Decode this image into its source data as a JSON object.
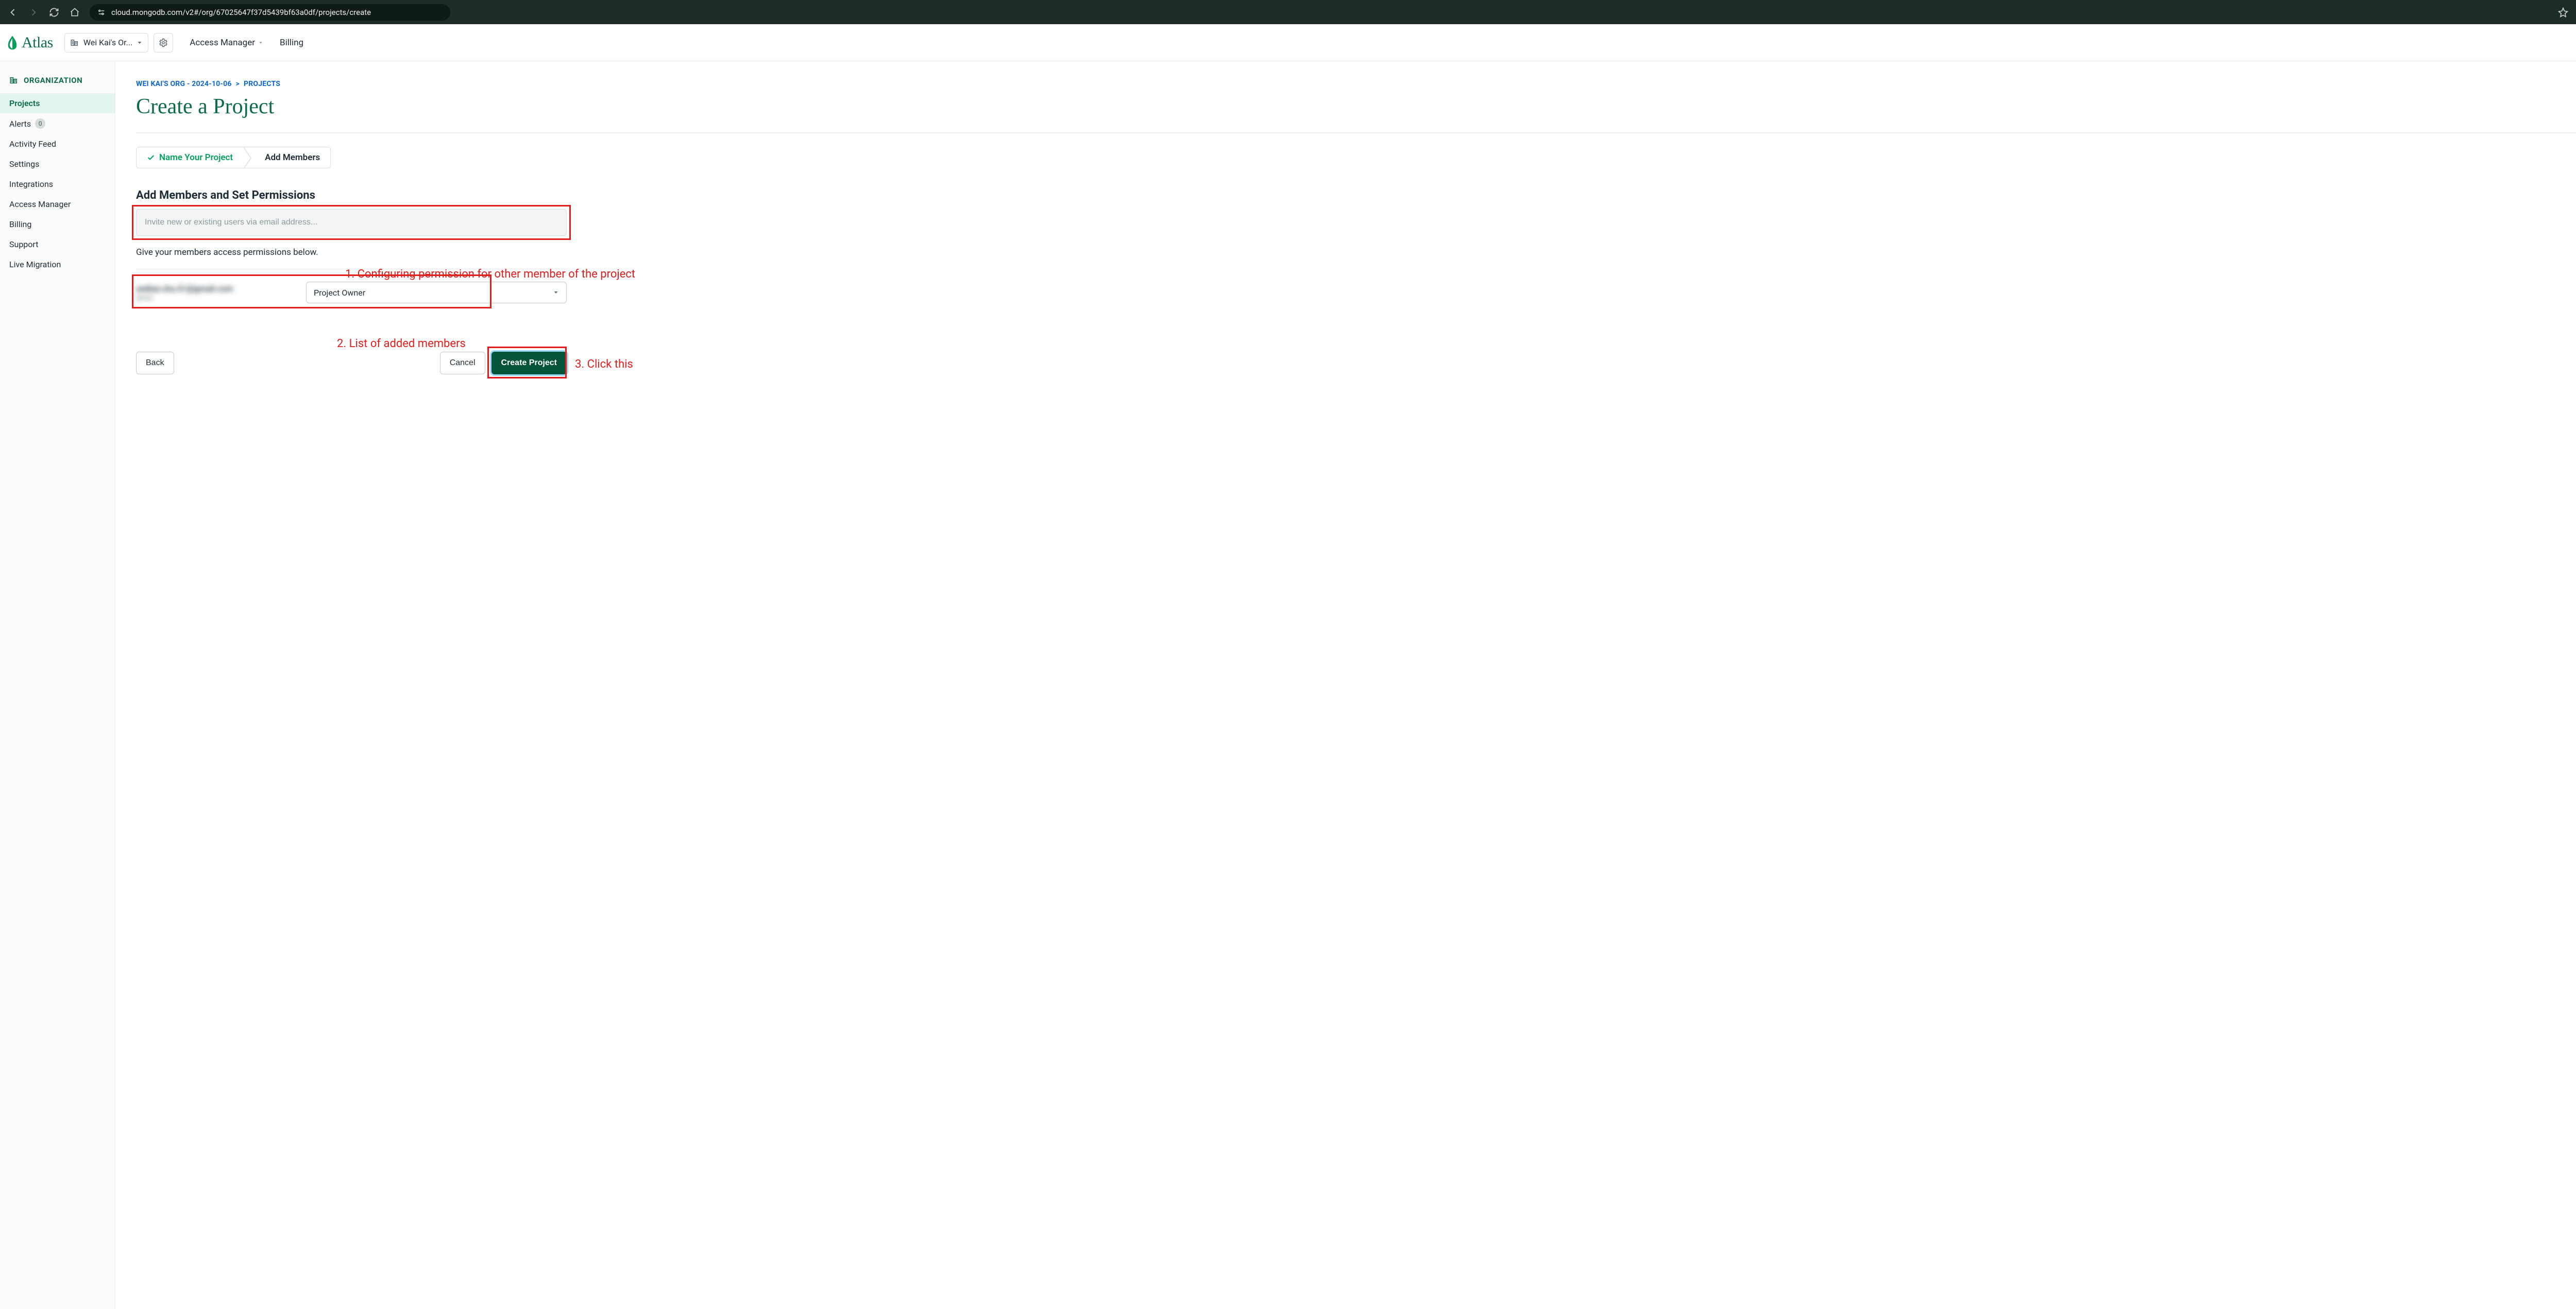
{
  "browser": {
    "url": "cloud.mongodb.com/v2#/org/67025647f37d5439bf63a0df/projects/create"
  },
  "topnav": {
    "logo": "Atlas",
    "org_label": "Wei Kai's Or...",
    "access_manager": "Access Manager",
    "billing": "Billing"
  },
  "sidebar": {
    "header": "ORGANIZATION",
    "items": [
      {
        "label": "Projects",
        "active": true
      },
      {
        "label": "Alerts",
        "badge": "0"
      },
      {
        "label": "Activity Feed"
      },
      {
        "label": "Settings"
      },
      {
        "label": "Integrations"
      },
      {
        "label": "Access Manager"
      },
      {
        "label": "Billing"
      },
      {
        "label": "Support"
      },
      {
        "label": "Live Migration"
      }
    ]
  },
  "breadcrumb": {
    "org": "WEI KAI'S ORG - 2024-10-06",
    "sep": ">",
    "page": "PROJECTS"
  },
  "page": {
    "title": "Create a Project",
    "step1": "Name Your Project",
    "step2": "Add Members",
    "section_title": "Add Members and Set Permissions",
    "invite_placeholder": "Invite new or existing users via email address...",
    "permissions_hint": "Give your members access permissions below.",
    "member_email": "weikai.chu.01@gmail.com",
    "member_you": "(you)",
    "role_selected": "Project Owner",
    "back": "Back",
    "cancel": "Cancel",
    "create": "Create Project"
  },
  "annotations": {
    "a1": "1. Configuring permission for other member of the project",
    "a2": "2. List of added members",
    "a3": "3. Click this"
  }
}
